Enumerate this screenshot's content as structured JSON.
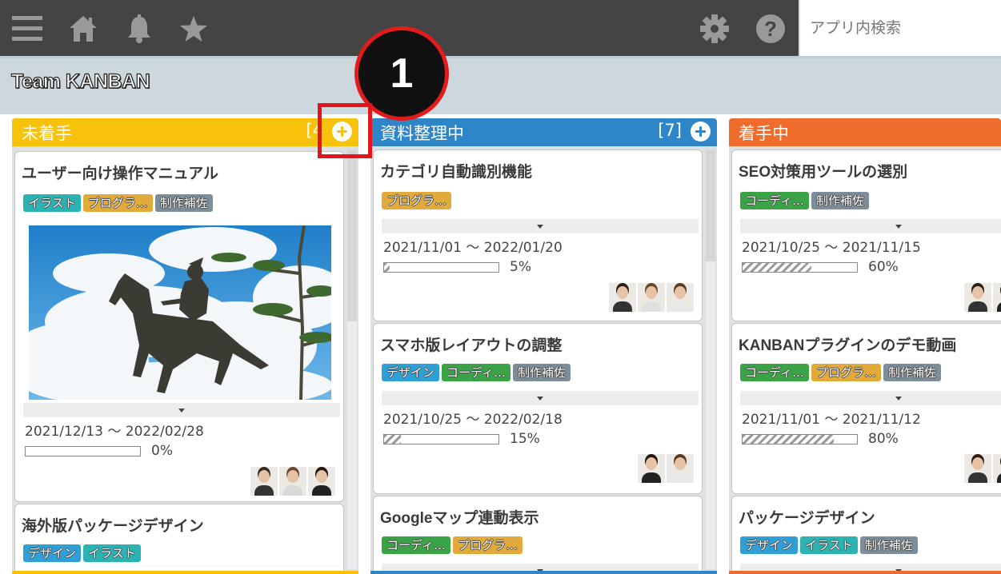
{
  "topbar": {
    "icons": [
      "menu-icon",
      "home-icon",
      "bell-icon",
      "star-icon",
      "gear-icon",
      "help-icon"
    ],
    "search_placeholder": "アプリ内検索"
  },
  "board": {
    "title": "Team KANBAN"
  },
  "annotation": {
    "step": "1"
  },
  "tag_colors": {
    "イラスト": "#2bb3b3",
    "プログラ…": "#e2a93b",
    "制作補佐": "#7b8e99",
    "デザイン": "#2f9fd8",
    "コーディ…": "#3aa346"
  },
  "columns": [
    {
      "name": "未着手",
      "count": "[4",
      "color": "#f8c10a",
      "cards": [
        {
          "title": "ユーザー向け操作マニュアル",
          "tags": [
            "イラスト",
            "プログラ…",
            "制作補佐"
          ],
          "image": "bronze-horse-statue-image",
          "dates": "2021/12/13 ～ 2022/02/28",
          "progress": 0,
          "progress_label": "0%",
          "avatars": 3
        },
        {
          "title": "海外版パッケージデザイン",
          "tags": [
            "デザイン",
            "イラスト"
          ]
        }
      ]
    },
    {
      "name": "資料整理中",
      "count": "[7]",
      "color": "#2e86c8",
      "cards": [
        {
          "title": "カテゴリ自動識別機能",
          "tags": [
            "プログラ…"
          ],
          "dates": "2021/11/01 ～ 2022/01/20",
          "progress": 5,
          "progress_label": "5%",
          "avatars": 3
        },
        {
          "title": "スマホ版レイアウトの調整",
          "tags": [
            "デザイン",
            "コーディ…",
            "制作補佐"
          ],
          "dates": "2021/10/25 ～ 2022/02/18",
          "progress": 15,
          "progress_label": "15%",
          "avatars": 2
        },
        {
          "title": "Googleマップ連動表示",
          "tags": [
            "コーディ…",
            "プログラ…"
          ]
        }
      ]
    },
    {
      "name": "着手中",
      "count": "",
      "color": "#ef6c2d",
      "cards": [
        {
          "title": "SEO対策用ツールの選別",
          "tags": [
            "コーディ…",
            "制作補佐"
          ],
          "dates": "2021/10/25 ～ 2021/11/15",
          "progress": 60,
          "progress_label": "60%",
          "avatars": 2
        },
        {
          "title": "KANBANプラグインのデモ動画",
          "tags": [
            "コーディ…",
            "プログラ…",
            "制作補佐"
          ],
          "dates": "2021/11/01 ～ 2021/11/12",
          "progress": 80,
          "progress_label": "80%",
          "avatars": 2
        },
        {
          "title": "パッケージデザイン",
          "tags": [
            "デザイン",
            "イラスト",
            "制作補佐"
          ]
        }
      ]
    }
  ]
}
